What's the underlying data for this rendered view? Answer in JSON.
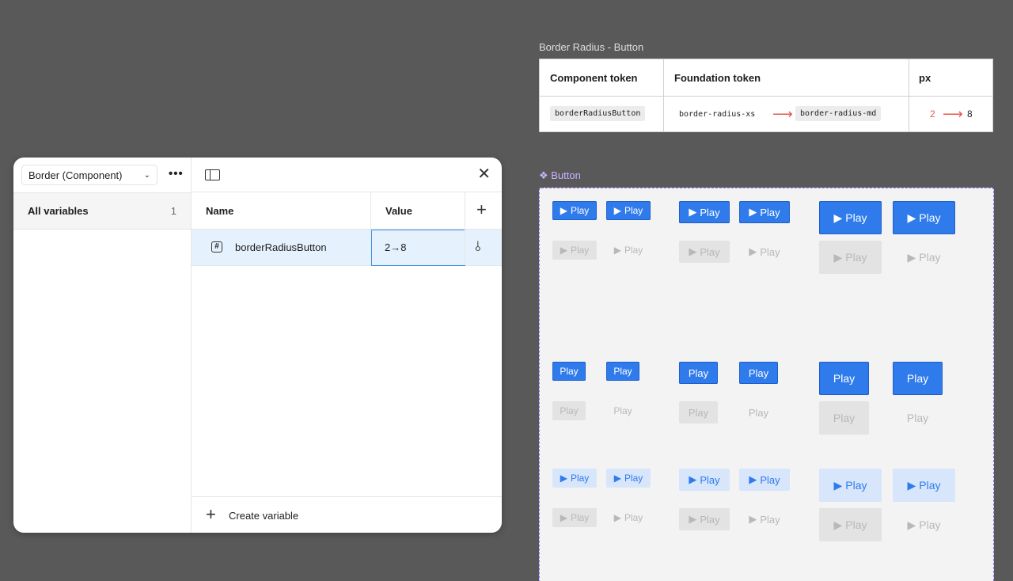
{
  "panel": {
    "collection_select": "Border (Component)",
    "more_label": "•••",
    "sidebar": {
      "all_variables": "All variables",
      "count": "1"
    },
    "table": {
      "col_name": "Name",
      "col_value": "Value",
      "add_label": "+"
    },
    "rows": [
      {
        "name": "borderRadiusButton",
        "value": "2→8",
        "type_icon": "#"
      }
    ],
    "footer": {
      "create_label": "Create variable"
    }
  },
  "tokens": {
    "title": "Border Radius - Button",
    "headers": {
      "component": "Component token",
      "foundation": "Foundation token",
      "px": "px"
    },
    "row": {
      "component_token": "borderRadiusButton",
      "foundation_from": "border-radius-xs",
      "foundation_to": "border-radius-md",
      "px_from": "2",
      "px_to": "8"
    },
    "arrow": "⟶",
    "colors": {
      "change": "#e05a4f"
    }
  },
  "component": {
    "label": "❖ Button",
    "button_label": "Play",
    "play_icon": "▶",
    "colors": {
      "primary": "#2f7bec",
      "soft": "#d7e6fb",
      "disabled": "#e3e3e3",
      "frame_border": "#9b73ff"
    }
  }
}
